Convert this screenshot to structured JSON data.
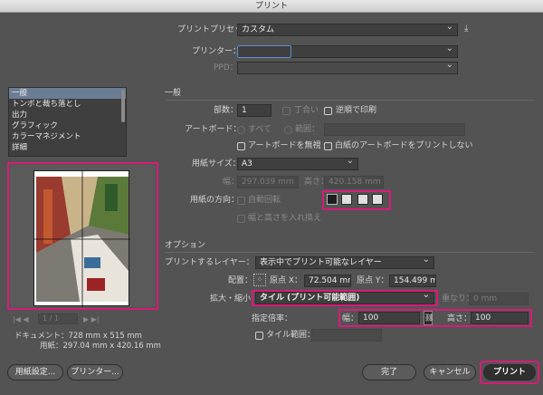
{
  "window": {
    "title": "プリント"
  },
  "preset": {
    "label": "プリントプリセット：",
    "value": "カスタム"
  },
  "printer": {
    "label": "プリンター：",
    "value": ""
  },
  "ppd": {
    "label": "PPD：",
    "value": ""
  },
  "sidebar": {
    "items": [
      {
        "label": "一般"
      },
      {
        "label": "トンボと裁ち落とし"
      },
      {
        "label": "出力"
      },
      {
        "label": "グラフィック"
      },
      {
        "label": "カラーマネジメント"
      },
      {
        "label": "詳細"
      }
    ]
  },
  "general": {
    "heading": "一般",
    "copies_label": "部数：",
    "copies_value": "1",
    "collate_label": "丁合い",
    "reverse_label": "逆順で印刷",
    "artboard_label": "アートボード：",
    "all_label": "すべて",
    "range_label": "範囲：",
    "ignore_artboards_label": "アートボードを無視",
    "skip_blank_label": "白紙のアートボードをプリントしない",
    "paper_size_label": "用紙サイズ：",
    "paper_size_value": "A3",
    "width_label": "幅：",
    "width_value": "297.039 mm",
    "height_label": "高さ：",
    "height_value": "420.158 mm",
    "orientation_label": "用紙の方向：",
    "auto_rotate_label": "自動回転",
    "transverse_label": "幅と高さを入れ換え"
  },
  "options": {
    "heading": "オプション",
    "layers_label": "プリントするレイヤー：",
    "layers_value": "表示中でプリント可能なレイヤー",
    "placement_label": "配置：",
    "origin_x_label": "原点 X：",
    "origin_x_value": "72.504 mm",
    "origin_y_label": "原点 Y：",
    "origin_y_value": "154.499 mm",
    "scaling_label": "拡大・縮小：",
    "scaling_value": "タイル (プリント可能範囲)",
    "overlap_label": "重なり：",
    "overlap_value": "0 mm",
    "scale_label": "指定倍率：",
    "scale_width_label": "幅：",
    "scale_width_value": "100",
    "scale_height_label": "高さ：",
    "scale_height_value": "100",
    "tile_range_label": "タイル範囲：",
    "tile_range_value": ""
  },
  "preview": {
    "page_indicator": "1 / 1",
    "document_label": "ドキュメント：728 mm x 515 mm",
    "paper_label": "用紙：297.04 mm x 420.16 mm"
  },
  "buttons": {
    "page_setup": "用紙設定...",
    "printer": "プリンター...",
    "done": "完了",
    "cancel": "キャンセル",
    "print": "プリント"
  },
  "colors": {
    "highlight": "#d81b7a",
    "background": "#535353",
    "selected_item": "#6a7d95"
  },
  "icons": [
    "printer-settings-icon",
    "collate-icon",
    "placement-grid-icon",
    "link-chain-icon",
    "portrait-icon",
    "landscape-icon",
    "rotated-portrait-icon",
    "rotated-landscape-icon"
  ]
}
